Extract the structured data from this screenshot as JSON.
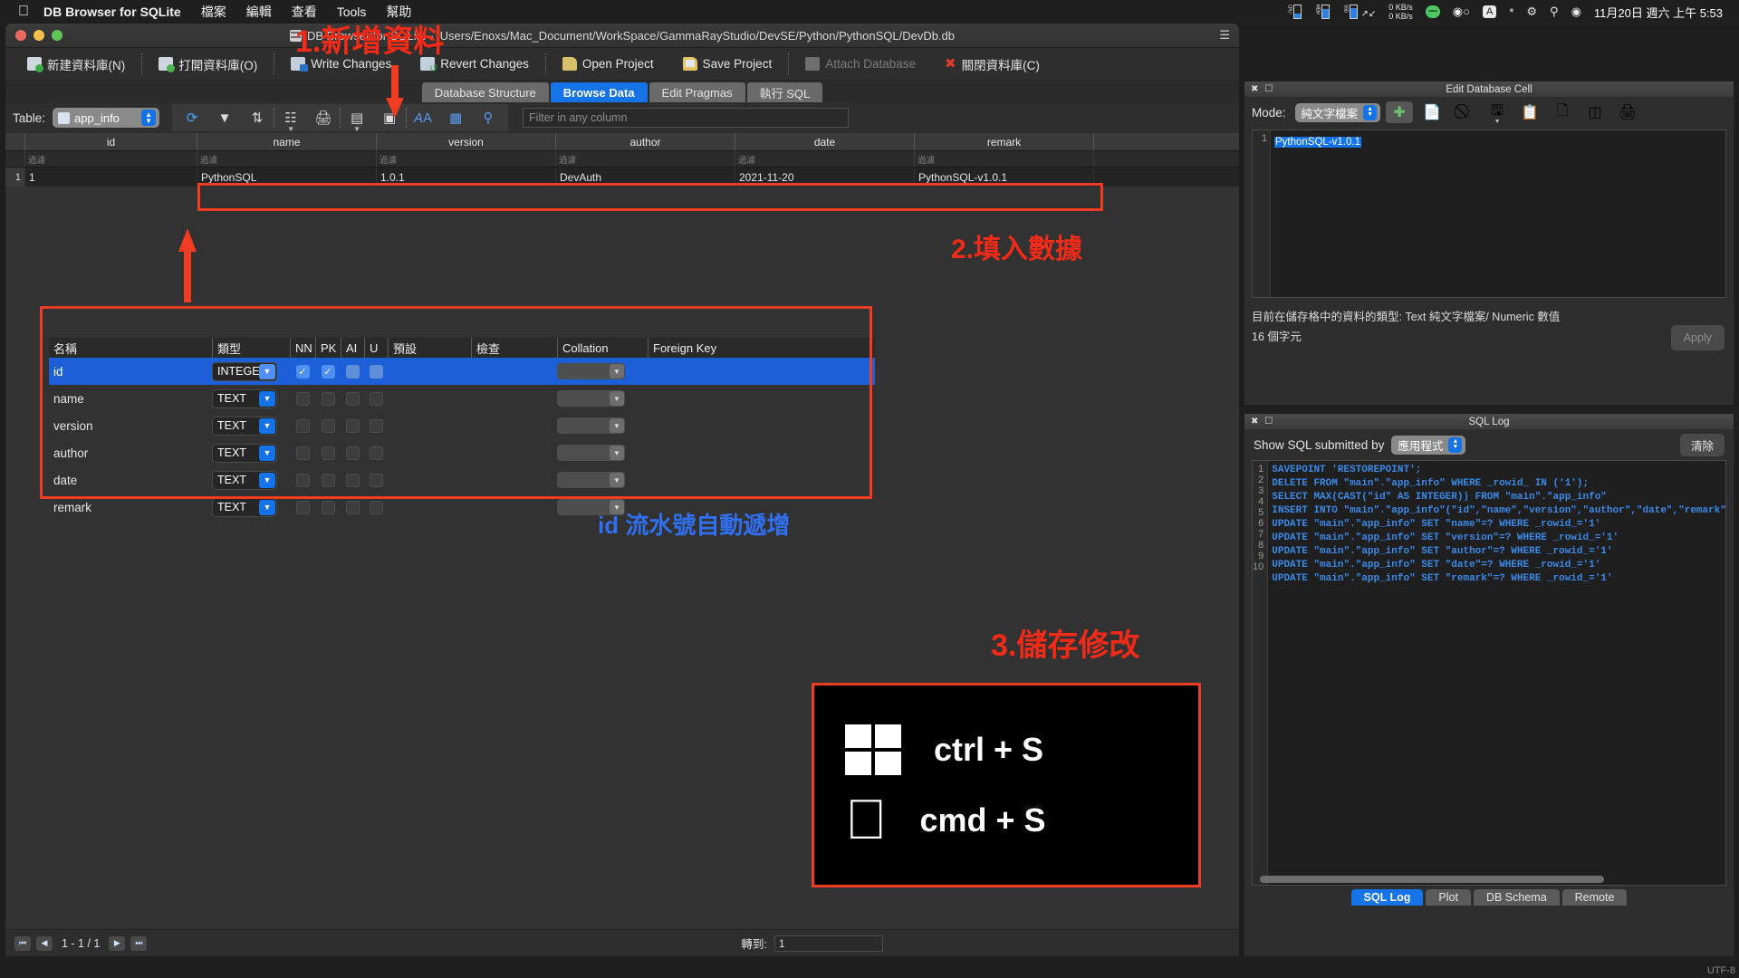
{
  "menubar": {
    "apple": "apple-logo",
    "app_name": "DB Browser for SQLite",
    "items": [
      "檔案",
      "編輯",
      "查看",
      "Tools",
      "幫助"
    ],
    "status": {
      "cpu_label": "CPU",
      "mem_label": "MEM",
      "ssd_label": "SSD",
      "net_up": "0 KB/s",
      "net_down": "0 KB/s"
    },
    "clock": "11月20日 週六 上午 5:53"
  },
  "window": {
    "title": "DB Browser for SQLite - /Users/Enoxs/Mac_Document/WorkSpace/GammaRayStudio/DevSE/Python/PythonSQL/DevDb.db"
  },
  "toolbar": {
    "buttons": [
      {
        "label": "新建資料庫(N)",
        "icon": "new-database-icon",
        "disabled": false
      },
      {
        "label": "打開資料庫(O)",
        "icon": "open-database-icon",
        "disabled": false
      },
      {
        "label": "Write Changes",
        "icon": "write-changes-icon",
        "disabled": false
      },
      {
        "label": "Revert Changes",
        "icon": "revert-changes-icon",
        "disabled": false
      },
      {
        "label": "Open Project",
        "icon": "open-project-icon",
        "disabled": false
      },
      {
        "label": "Save Project",
        "icon": "save-project-icon",
        "disabled": false
      },
      {
        "label": "Attach Database",
        "icon": "attach-database-icon",
        "disabled": true
      },
      {
        "label": "關閉資料庫(C)",
        "icon": "close-database-icon",
        "disabled": false
      }
    ]
  },
  "tabs": [
    {
      "label": "Database Structure",
      "active": false
    },
    {
      "label": "Browse Data",
      "active": true
    },
    {
      "label": "Edit Pragmas",
      "active": false
    },
    {
      "label": "執行 SQL",
      "active": false
    }
  ],
  "table_bar": {
    "label": "Table:",
    "selected_table": "app_info",
    "icons": [
      "refresh-icon",
      "filter-icon",
      "sort-icon",
      "copy-icon",
      "print-icon",
      "insert-record-icon",
      "delete-record-icon",
      "font-icon",
      "conditional-format-icon",
      "find-replace-icon"
    ],
    "filter_placeholder": "Filter in any column"
  },
  "grid": {
    "columns": [
      "id",
      "name",
      "version",
      "author",
      "date",
      "remark"
    ],
    "filter_placeholder": "過濾",
    "rows": [
      {
        "row_number": "1",
        "cells": [
          "1",
          "PythonSQL",
          "1.0.1",
          "DevAuth",
          "2021-11-20",
          "PythonSQL-v1.0.1"
        ]
      }
    ]
  },
  "schema_editor": {
    "headers": [
      "名稱",
      "類型",
      "NN",
      "PK",
      "AI",
      "U",
      "預設",
      "檢查",
      "Collation",
      "Foreign Key"
    ],
    "fields": [
      {
        "name": "id",
        "type": "INTEGER",
        "nn": true,
        "pk": true,
        "ai": false,
        "u": false,
        "default": "",
        "check": "",
        "collation": "",
        "fk": "",
        "selected": true
      },
      {
        "name": "name",
        "type": "TEXT",
        "nn": false,
        "pk": false,
        "ai": false,
        "u": false,
        "default": "",
        "check": "",
        "collation": "",
        "fk": "",
        "selected": false
      },
      {
        "name": "version",
        "type": "TEXT",
        "nn": false,
        "pk": false,
        "ai": false,
        "u": false,
        "default": "",
        "check": "",
        "collation": "",
        "fk": "",
        "selected": false
      },
      {
        "name": "author",
        "type": "TEXT",
        "nn": false,
        "pk": false,
        "ai": false,
        "u": false,
        "default": "",
        "check": "",
        "collation": "",
        "fk": "",
        "selected": false
      },
      {
        "name": "date",
        "type": "TEXT",
        "nn": false,
        "pk": false,
        "ai": false,
        "u": false,
        "default": "",
        "check": "",
        "collation": "",
        "fk": "",
        "selected": false
      },
      {
        "name": "remark",
        "type": "TEXT",
        "nn": false,
        "pk": false,
        "ai": false,
        "u": false,
        "default": "",
        "check": "",
        "collation": "",
        "fk": "",
        "selected": false
      }
    ]
  },
  "pager": {
    "range_text": "1 - 1 / 1",
    "goto_label": "轉到:",
    "goto_value": "1"
  },
  "edit_cell": {
    "title": "Edit Database Cell",
    "mode_label": "Mode:",
    "mode_value": "純文字檔案",
    "content_line_number": "1",
    "content": "PythonSQL-v1.0.1",
    "type_info": "目前在儲存格中的資料的類型: Text 純文字檔案/ Numeric 數值",
    "char_count": "16 個字元",
    "apply_label": "Apply",
    "toolbar_icons": [
      "import-icon",
      "export-icon",
      "set-as-null-icon",
      "save-as-icon",
      "copy-cell-icon",
      "paste-cell-icon",
      "open-in-editor-icon",
      "print-cell-icon"
    ]
  },
  "sql_log": {
    "title": "SQL Log",
    "show_label": "Show SQL submitted by",
    "source_value": "應用程式",
    "clear_label": "清除",
    "lines": [
      {
        "n": "1",
        "sql": "SAVEPOINT 'RESTOREPOINT';"
      },
      {
        "n": "2",
        "sql": "DELETE FROM \"main\".\"app_info\" WHERE _rowid_ IN ('1');"
      },
      {
        "n": "3",
        "sql": "SELECT MAX(CAST(\"id\" AS INTEGER)) FROM \"main\".\"app_info\""
      },
      {
        "n": "4",
        "sql": "INSERT INTO \"main\".\"app_info\"(\"id\",\"name\",\"version\",\"author\",\"date\",\"remark\") VALUE"
      },
      {
        "n": "5",
        "sql": "UPDATE \"main\".\"app_info\" SET \"name\"=? WHERE _rowid_='1'"
      },
      {
        "n": "6",
        "sql": "UPDATE \"main\".\"app_info\" SET \"version\"=? WHERE _rowid_='1'"
      },
      {
        "n": "7",
        "sql": "UPDATE \"main\".\"app_info\" SET \"author\"=? WHERE _rowid_='1'"
      },
      {
        "n": "8",
        "sql": "UPDATE \"main\".\"app_info\" SET \"date\"=? WHERE _rowid_='1'"
      },
      {
        "n": "9",
        "sql": "UPDATE \"main\".\"app_info\" SET \"remark\"=? WHERE _rowid_='1'"
      },
      {
        "n": "10",
        "sql": ""
      }
    ],
    "tabs": [
      {
        "label": "SQL Log",
        "active": true
      },
      {
        "label": "Plot",
        "active": false
      },
      {
        "label": "DB Schema",
        "active": false
      },
      {
        "label": "Remote",
        "active": false
      }
    ]
  },
  "annotations": {
    "step1": "1.新增資料",
    "step2": "2.填入數據",
    "step3_note": "id 流水號自動遞增",
    "step3": "3.儲存修改",
    "windows_shortcut": "ctrl + S",
    "mac_shortcut": "cmd + S",
    "accent_red": "#f03c22",
    "accent_blue": "#2f6ff0"
  },
  "status": {
    "encoding": "UTF-8"
  }
}
